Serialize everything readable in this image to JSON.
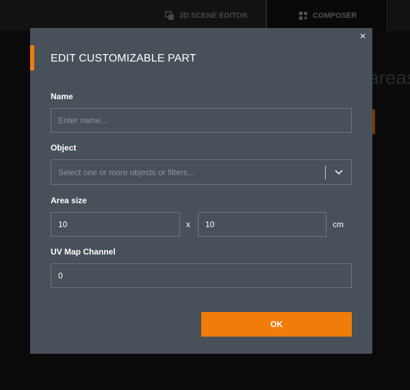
{
  "topbar": {
    "tabs": [
      {
        "label": "3D SCENE EDITOR",
        "icon": "copy-icon"
      },
      {
        "label": "COMPOSER",
        "icon": "composer-icon"
      }
    ]
  },
  "background": {
    "partial_text": "areas"
  },
  "modal": {
    "title": "EDIT CUSTOMIZABLE PART",
    "close_glyph": "×",
    "name": {
      "label": "Name",
      "placeholder": "Enter name...",
      "value": ""
    },
    "object": {
      "label": "Object",
      "placeholder": "Select one or more objects or filters..."
    },
    "area_size": {
      "label": "Area size",
      "width": "10",
      "height": "10",
      "separator": "x",
      "unit": "cm"
    },
    "uv_map": {
      "label": "UV Map Channel",
      "value": "0"
    },
    "ok_label": "OK"
  },
  "colors": {
    "accent": "#f07c0a",
    "modal_bg": "#485159",
    "input_border": "#6f7880"
  }
}
